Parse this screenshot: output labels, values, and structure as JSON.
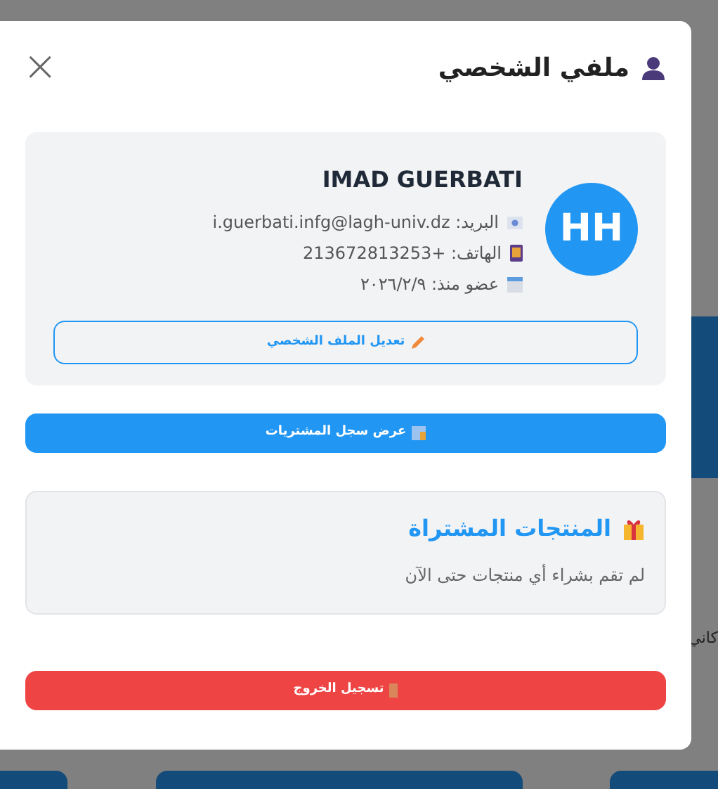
{
  "modal": {
    "title": "ملفي الشخصي",
    "close": "×"
  },
  "profile": {
    "avatar": "HH",
    "name": "IMAD GUERBATI",
    "details": [
      {
        "kind": "email",
        "text": "البريد: i.guerbati.infg@lagh-univ.dz"
      },
      {
        "kind": "phone",
        "text": "الهاتف: +213672813253"
      },
      {
        "kind": "date",
        "text": "عضو منذ: ٢٠٢٦/٢/٩"
      }
    ],
    "edit_button": "تعديل الملف الشخصي"
  },
  "history_button": "عرض سجل المشتريات",
  "purchased": {
    "title": "المنتجات المشتراة",
    "empty": "لم تقم بشراء أي منتجات حتى الآن"
  },
  "logout_button": "تسجيل الخروج",
  "background": {
    "cut_text": "كاني"
  }
}
